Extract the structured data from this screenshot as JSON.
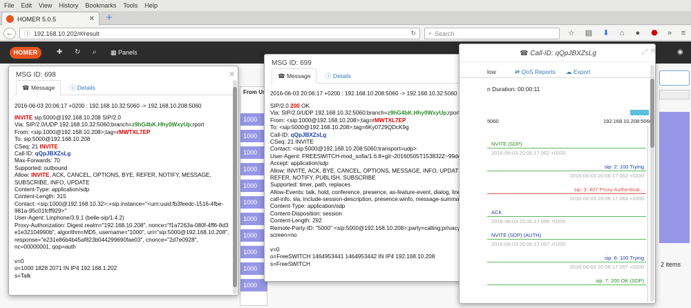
{
  "browser": {
    "menu": [
      "File",
      "Edit",
      "View",
      "History",
      "Bookmarks",
      "Tools",
      "Help"
    ],
    "tab_title": "HOMER 5.0.5",
    "url": "192.168.10.202/#/result",
    "search_placeholder": "Search",
    "toolbar_icons": [
      "star-icon",
      "clipboard-icon",
      "pocket-icon",
      "download-icon",
      "home-icon",
      "chat-icon",
      "abp-icon",
      "menu-icon"
    ]
  },
  "app": {
    "logo": "HOMER",
    "panels_label": "Panels",
    "bg_header": "From Us",
    "bg_rows": [
      "1000",
      "1000",
      "1000",
      "1000",
      "1000",
      "1000",
      "1000",
      "1000",
      "1000",
      "1000",
      "1000",
      "1000",
      "1000"
    ],
    "items_count": "2 items"
  },
  "dialog1": {
    "title": "MSG ID: 698",
    "tab_message": "Message",
    "tab_details": "Details",
    "timestamp": "2016-06-03 20:06:17 +0200 : 192.168.10.32:5060 -> 192.168.10.208:5060",
    "lines": [
      [
        {
          "t": "INVITE",
          "c": "red"
        },
        {
          "t": " sip:5000@192.168.10.208 SIP/2.0"
        }
      ],
      [
        {
          "t": "Via: SIP/2.0/UDP 192.168.10.32:5060;branch="
        },
        {
          "t": "z9hG4bK.Hhy0WxyUp",
          "c": "grn"
        },
        {
          "t": ";rport"
        }
      ],
      [
        {
          "t": "From: <sip:1000@192.168.10.208>;tag="
        },
        {
          "t": "rMWTXL7EP",
          "c": "red"
        }
      ],
      [
        {
          "t": "To: sip:5000@192.168.10.208"
        }
      ],
      [
        {
          "t": "CSeq: 21 "
        },
        {
          "t": "INVITE",
          "c": "red"
        }
      ],
      [
        {
          "t": "Call-ID: "
        },
        {
          "t": "qQpJBXZsLg",
          "c": "blu"
        }
      ],
      [
        {
          "t": "Max-Forwards: 70"
        }
      ],
      [
        {
          "t": "Supported: outbound"
        }
      ],
      [
        {
          "t": "Allow: "
        },
        {
          "t": "INVITE",
          "c": "red"
        },
        {
          "t": ", ACK, CANCEL, OPTIONS, BYE, REFER, NOTIFY, MESSAGE,"
        }
      ],
      [
        {
          "t": "SUBSCRIBE, INFO, UPDATE"
        }
      ],
      [
        {
          "t": "Content-Type: application/sdp"
        }
      ],
      [
        {
          "t": "Content-Length: 315"
        }
      ],
      [
        {
          "t": "Contact: <sip:1000@192.168.10.32>;+sip.instance=\"<urn:uuid:fb3feedc-1516-4fbe-"
        }
      ],
      [
        {
          "t": "981a-95c01fcff929>\""
        }
      ],
      [
        {
          "t": "User-Agent: Linphone/3.9.1 (belle-sip/1.4.2)"
        }
      ],
      [
        {
          "t": "Proxy-Authorization:  Digest realm=\"192.168.10.208\", nonce=\"f1a7263a-080f-4ff6-8d3f-"
        }
      ],
      [
        {
          "t": "e1e32104990b\", algorithm=MD5, username=\"1000\",  uri=\"sip:5000@192.168.10.208\","
        }
      ],
      [
        {
          "t": "response=\"e231e86b4b45af823b044299690fae03\", cnonce=\"2d7e0928\","
        }
      ],
      [
        {
          "t": "nc=00000001, qop=auth"
        }
      ],
      [
        {
          "t": ""
        }
      ],
      [
        {
          "t": "v=0"
        }
      ],
      [
        {
          "t": "o=1000 1828 2071 IN IP4 192.168.1.202"
        }
      ],
      [
        {
          "t": "s=Talk"
        }
      ]
    ]
  },
  "dialog2": {
    "title": "MSG ID: 699",
    "tab_message": "Message",
    "tab_details": "Details",
    "timestamp": "2016-06-03 20:06:17 +0200 : 192.168.10.208:5060 -> 192.168.10.32:5060",
    "lines": [
      [
        {
          "t": "SIP/2.0 "
        },
        {
          "t": "200",
          "c": "red"
        },
        {
          "t": " OK"
        }
      ],
      [
        {
          "t": "Via: SIP/2.0/UDP 192.168.10.32:5060;branch="
        },
        {
          "t": "z9hG4bK.Hhy0WxyUp",
          "c": "grn"
        },
        {
          "t": ";rport=5060"
        }
      ],
      [
        {
          "t": "From: <sip:1000@192.168.10.208>;tag="
        },
        {
          "t": "rMWTXL7EP",
          "c": "red"
        }
      ],
      [
        {
          "t": "To: <sip:5000@192.168.10.208>;tag=6Ky0729QDcK9g"
        }
      ],
      [
        {
          "t": "Call-ID: "
        },
        {
          "t": "qQpJBXZsLg",
          "c": "blu"
        }
      ],
      [
        {
          "t": "CSeq: 21 INVITE"
        }
      ],
      [
        {
          "t": "Contact: <sip:5000@192.168.10.208:5060;transport=udp>"
        }
      ],
      [
        {
          "t": "User-Agent: FREESWITCH-mod_sofia/1.6.8+git~20160505T153832Z~99de0ad502~64bit"
        }
      ],
      [
        {
          "t": "Accept: application/sdp"
        }
      ],
      [
        {
          "t": "Allow: INVITE, ACK, BYE, CANCEL, OPTIONS, MESSAGE, INFO, UPDATE, REGISTER,"
        }
      ],
      [
        {
          "t": "REFER, NOTIFY, PUBLISH, SUBSCRIBE"
        }
      ],
      [
        {
          "t": "Supported: timer, path, replaces"
        }
      ],
      [
        {
          "t": "Allow-Events: talk, hold, conference, presence, as-feature-event, dialog, line-seize,"
        }
      ],
      [
        {
          "t": "call-info, sla, include-session-description, presence.winfo, message-summary, refer"
        }
      ],
      [
        {
          "t": "Content-Type: application/sdp"
        }
      ],
      [
        {
          "t": "Content-Disposition: session"
        }
      ],
      [
        {
          "t": "Content-Length: 292"
        }
      ],
      [
        {
          "t": "Remote-Party-ID: \"5000\" <sip:5000@192.168.10.208>;party=calling;privacy=off;"
        }
      ],
      [
        {
          "t": "screen=no"
        }
      ],
      [
        {
          "t": ""
        }
      ],
      [
        {
          "t": "v=0"
        }
      ],
      [
        {
          "t": "o=FreeSWITCH 1464953441 1464953442 IN IP4 192.168.10.208"
        }
      ],
      [
        {
          "t": "s=FreeSWITCH"
        }
      ]
    ]
  },
  "callflow": {
    "title": "Call-ID: qQpJBXZsLg",
    "tab_flow": "low",
    "tab_qos": "QoS Reports",
    "tab_export": "Export",
    "duration": "n Duration: 00:00:11",
    "host_left": "5060",
    "host_right": "192.168.10.208:5060",
    "messages": [
      {
        "label": "NVITE  (SDP)",
        "ts": "2016-06-03 20:06:17.062 +0200",
        "side": "left",
        "color": "green"
      },
      {
        "label": "sip: 2: 100 Trying",
        "ts": "2016-06-03 20:06:17.063 +0200",
        "side": "right",
        "color": "blue"
      },
      {
        "label": "sip: 3: 407 Proxy Authenticat...",
        "ts": "2016-06-03 20:06:17.063 +0200",
        "side": "right",
        "color": "red"
      },
      {
        "label": "ACK",
        "ts": "2016-06-03 20:06:17.096 +0200",
        "side": "left",
        "color": "blue"
      },
      {
        "label": "NVITE  (SDP)  (AUTH)",
        "ts": "2016-06-03 20:06:17.097 +0200",
        "side": "left",
        "color": "blue"
      },
      {
        "label": "sip: 6: 100 Trying",
        "ts": "2016-06-03 20:06:17.097 +0200",
        "side": "right",
        "color": "blue"
      },
      {
        "label": "sip: 7: 200 OK (SDP)",
        "ts": "",
        "side": "right",
        "color": "green"
      }
    ]
  }
}
